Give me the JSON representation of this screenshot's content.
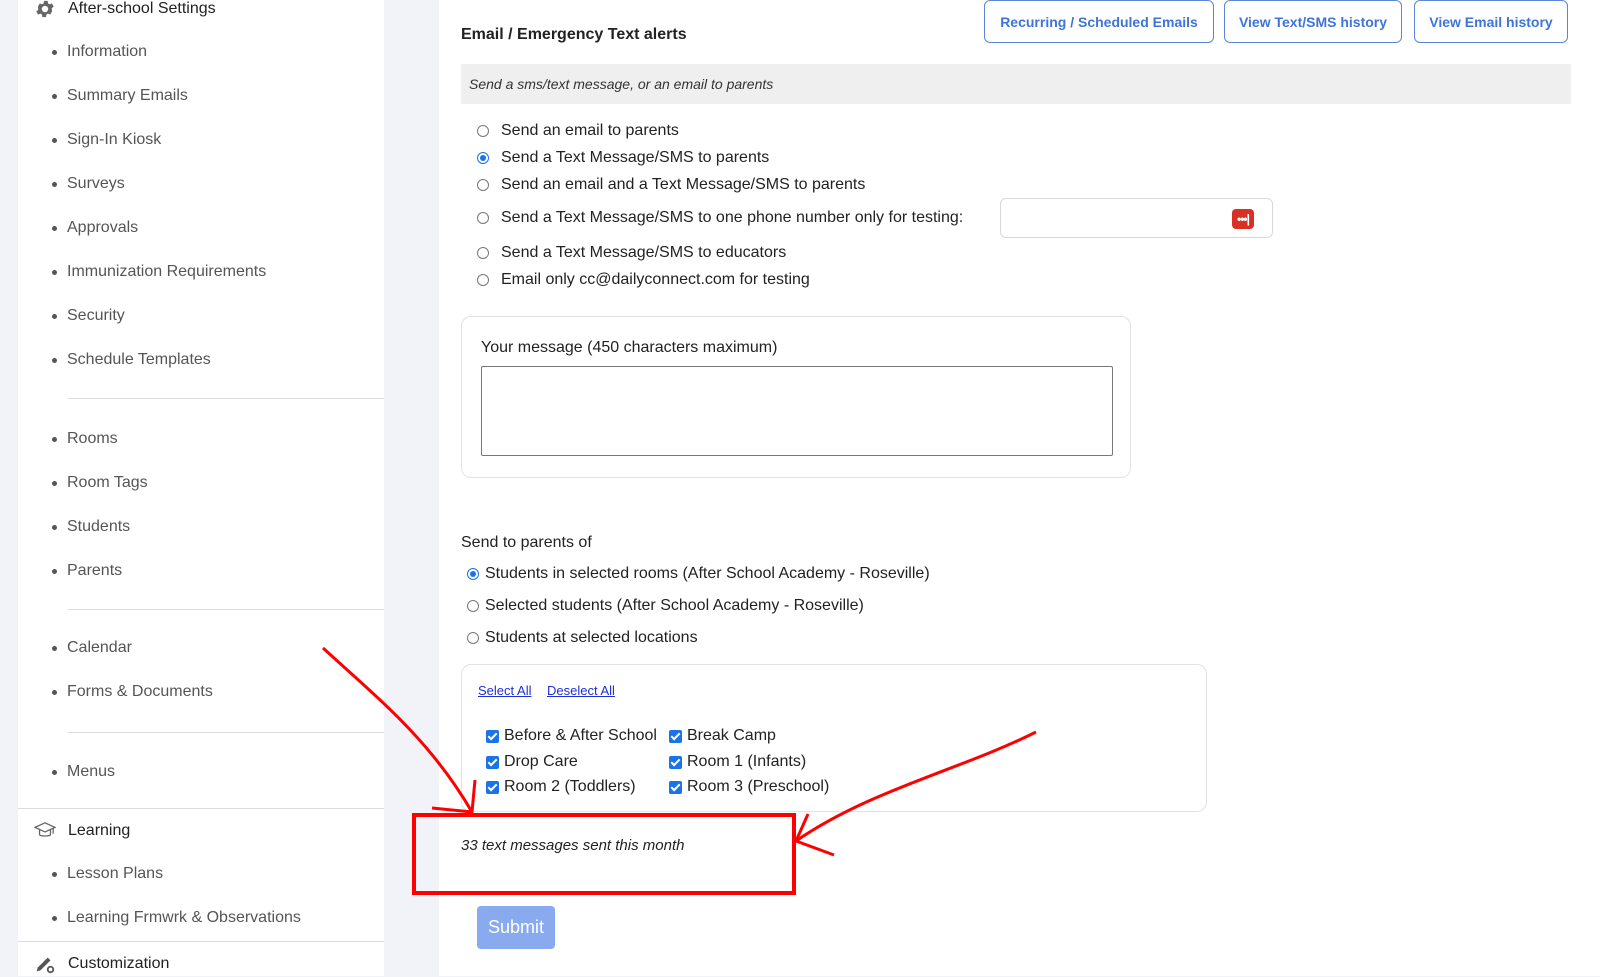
{
  "sidebar": {
    "settings_section": {
      "label": "After-school Settings",
      "icon": "gear-icon"
    },
    "settings_items": [
      "Information",
      "Summary Emails",
      "Sign-In Kiosk",
      "Surveys",
      "Approvals",
      "Immunization Requirements",
      "Security",
      "Schedule Templates"
    ],
    "people_items": [
      "Rooms",
      "Room Tags",
      "Students",
      "Parents"
    ],
    "calendar_items": [
      "Calendar",
      "Forms & Documents"
    ],
    "menu_items": [
      "Menus"
    ],
    "learning_section": {
      "label": "Learning",
      "icon": "graduation-cap-icon"
    },
    "learning_items": [
      "Lesson Plans",
      "Learning Frmwrk & Observations"
    ],
    "customization_section": {
      "label": "Customization",
      "icon": "pencil-gear-icon"
    }
  },
  "header": {
    "title": "Email / Emergency Text alerts",
    "buttons": {
      "recurring": "Recurring / Scheduled Emails",
      "sms_history": "View Text/SMS history",
      "email_history": "View Email history"
    }
  },
  "info_bar": "Send a sms/text message, or an email to parents",
  "send_options": [
    {
      "label": "Send an email to parents",
      "selected": false
    },
    {
      "label": "Send a Text Message/SMS to parents",
      "selected": true
    },
    {
      "label": "Send an email and a Text Message/SMS to parents",
      "selected": false
    },
    {
      "label": "Send a Text Message/SMS to one phone number only for testing:",
      "selected": false
    },
    {
      "label": "Send a Text Message/SMS to educators",
      "selected": false
    },
    {
      "label": "Email only cc@dailyconnect.com for testing",
      "selected": false
    }
  ],
  "test_phone": {
    "value": "",
    "icon": "password-dots-icon",
    "icon_glyph": "•••|"
  },
  "message": {
    "label": "Your message (450 characters maximum)",
    "value": ""
  },
  "send_to": {
    "label": "Send to parents of",
    "options": [
      {
        "label": "Students in selected rooms (After School Academy - Roseville)",
        "selected": true
      },
      {
        "label": "Selected students (After School Academy - Roseville)",
        "selected": false
      },
      {
        "label": "Students at selected locations",
        "selected": false
      }
    ]
  },
  "rooms": {
    "select_all": "Select All",
    "deselect_all": "Deselect All",
    "items": [
      {
        "label": "Before & After School",
        "checked": true
      },
      {
        "label": "Break Camp",
        "checked": true
      },
      {
        "label": "Drop Care",
        "checked": true
      },
      {
        "label": "Room 1 (Infants)",
        "checked": true
      },
      {
        "label": "Room 2 (Toddlers)",
        "checked": true
      },
      {
        "label": "Room 3 (Preschool)",
        "checked": true
      }
    ]
  },
  "sent_count": "33 text messages sent this month",
  "submit_label": "Submit",
  "colors": {
    "accent": "#3e74d8",
    "annotation": "#ff0000",
    "submit": "#8aaaf0"
  }
}
